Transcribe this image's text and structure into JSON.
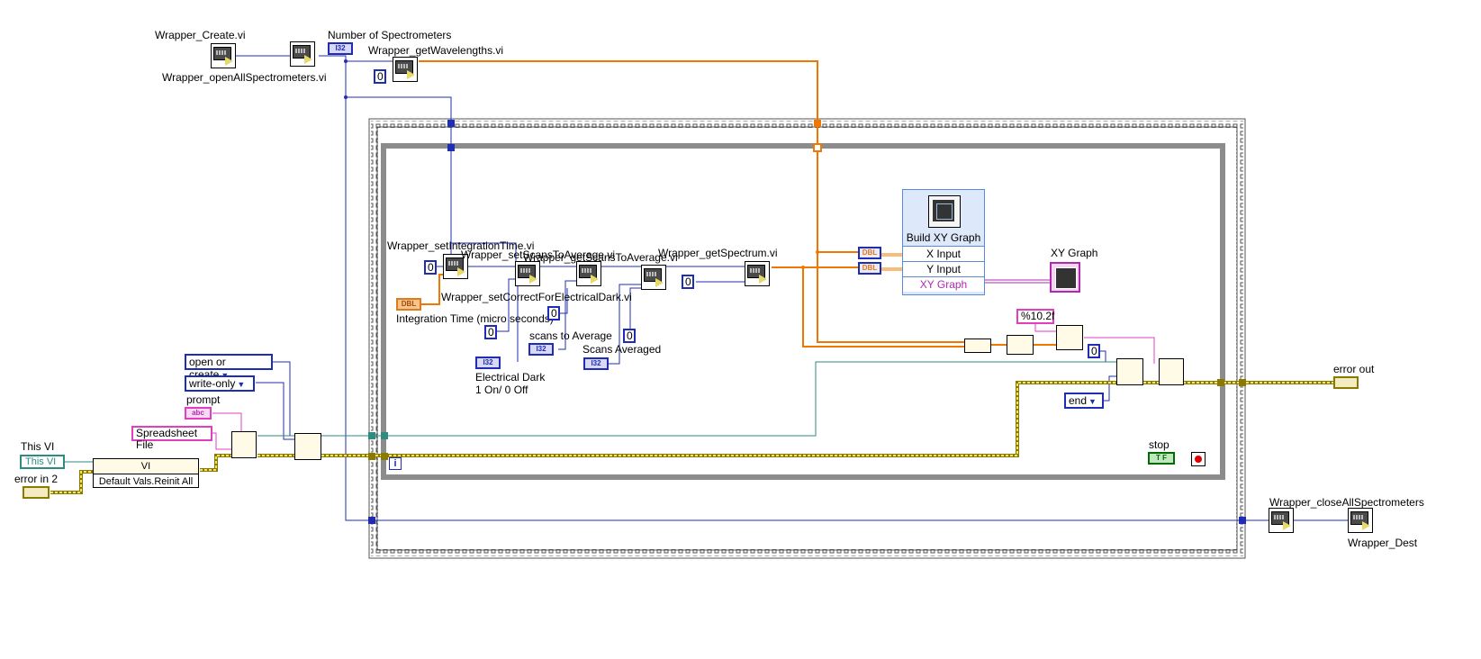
{
  "labels": {
    "wrapper_create": "Wrapper_Create.vi",
    "wrapper_open_all": "Wrapper_openAllSpectrometers.vi",
    "number_of_spectrometers": "Number of Spectrometers",
    "wrapper_get_wavelengths": "Wrapper_getWavelengths.vi",
    "wrapper_set_integration_time": "Wrapper_setIntegrationTime.vi",
    "wrapper_set_scans_to_average": "Wrapper_setScansToAverage.vi",
    "wrapper_get_scans_to_average": "Wrapper_getScansToAverage.vi",
    "wrapper_get_spectrum": "Wrapper_getSpectrum.vi",
    "wrapper_set_correct_electrical_dark": "Wrapper_setCorrectForElectricalDark.vi",
    "integration_time": "Integration Time (micro seconds)",
    "scans_to_average": "scans to Average",
    "scans_averaged": "Scans Averaged",
    "electrical_dark_1": "Electrical Dark",
    "electrical_dark_2": "1 On/ 0 Off",
    "xy_graph": "XY Graph",
    "stop": "stop",
    "error_out": "error out",
    "prompt": "prompt",
    "this_vi": "This VI",
    "error_in_2": "error in 2",
    "wrapper_close_all": "Wrapper_closeAllSpectrometers",
    "wrapper_destroy": "Wrapper_Dest"
  },
  "constants": {
    "zero": "0",
    "format_string": "%10.2f",
    "spreadsheet_file": "Spreadsheet File",
    "open_or_create": "open or create",
    "write_only": "write-only",
    "end": "end",
    "this_vi_ref": "This VI"
  },
  "type_tags": {
    "i32": "I32",
    "dbl": "DBL",
    "abc": "abc",
    "tf": "T F",
    "iter": "i"
  },
  "build_xy_graph": {
    "title": "Build XY Graph",
    "rows": [
      "X Input",
      "Y Input",
      "XY Graph"
    ]
  },
  "property_node": {
    "class": "VI",
    "property": "Default Vals.Reinit All"
  },
  "colors": {
    "int_wire": "#1f2db5",
    "dbl_wire": "#f07800",
    "error_wire": "#8a7a00",
    "refnum_wire": "#2e8b80",
    "string_wire": "#e040c0",
    "cluster_wire": "#b02ab0",
    "loop_frame": "#8c8c8c"
  }
}
